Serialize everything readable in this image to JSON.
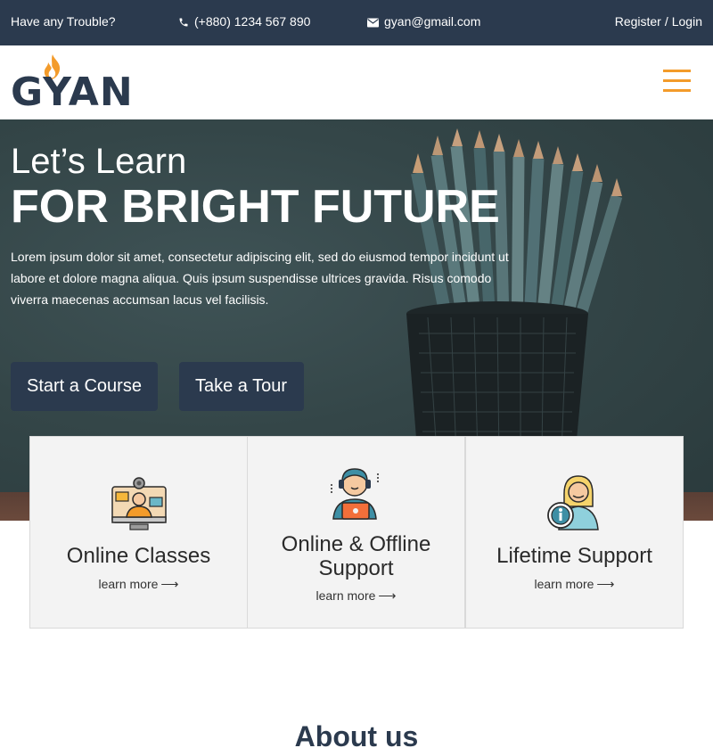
{
  "topbar": {
    "trouble": "Have any Trouble?",
    "phone": "(+880) 1234 567 890",
    "email": "gyan@gmail.com",
    "register": "Register",
    "separator": "/",
    "login": "Login"
  },
  "header": {
    "logo_text": "GYAN",
    "menu_icon": "hamburger-icon"
  },
  "hero": {
    "subtitle": "Let’s Learn",
    "title": "FOR BRIGHT FUTURE",
    "text": "Lorem ipsum dolor sit amet, consectetur adipiscing elit, sed do eiusmod tempor incidunt ut labore et dolore magna aliqua. Quis ipsum suspendisse ultrices gravida. Risus comodo viverra maecenas accumsan lacus vel facilisis.",
    "primary_button": "Start a Course",
    "secondary_button": "Take a Tour"
  },
  "features": [
    {
      "title": "Online Classes",
      "link": "learn more",
      "icon": "online-class-icon"
    },
    {
      "title": "Online & Offline Support",
      "link": "learn more",
      "icon": "support-agent-icon"
    },
    {
      "title": "Lifetime Support",
      "link": "learn more",
      "icon": "info-support-icon"
    }
  ],
  "about": {
    "title": "About us"
  },
  "colors": {
    "navy": "#2b3a4e",
    "accent": "#f39b2a",
    "card_bg": "#f3f3f3"
  }
}
